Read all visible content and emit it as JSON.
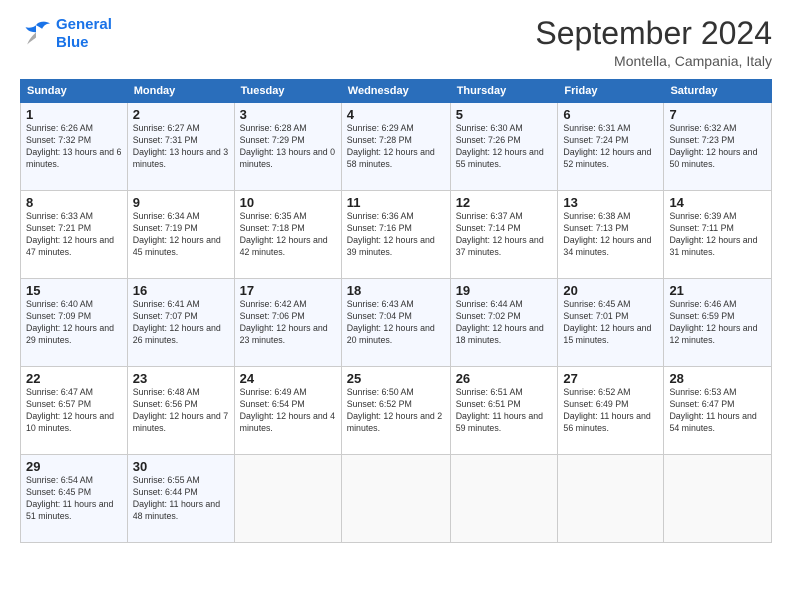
{
  "logo": {
    "line1": "General",
    "line2": "Blue"
  },
  "title": "September 2024",
  "location": "Montella, Campania, Italy",
  "days_of_week": [
    "Sunday",
    "Monday",
    "Tuesday",
    "Wednesday",
    "Thursday",
    "Friday",
    "Saturday"
  ],
  "weeks": [
    [
      {
        "day": "1",
        "sunrise": "6:26 AM",
        "sunset": "7:32 PM",
        "daylight": "13 hours and 6 minutes."
      },
      {
        "day": "2",
        "sunrise": "6:27 AM",
        "sunset": "7:31 PM",
        "daylight": "13 hours and 3 minutes."
      },
      {
        "day": "3",
        "sunrise": "6:28 AM",
        "sunset": "7:29 PM",
        "daylight": "13 hours and 0 minutes."
      },
      {
        "day": "4",
        "sunrise": "6:29 AM",
        "sunset": "7:28 PM",
        "daylight": "12 hours and 58 minutes."
      },
      {
        "day": "5",
        "sunrise": "6:30 AM",
        "sunset": "7:26 PM",
        "daylight": "12 hours and 55 minutes."
      },
      {
        "day": "6",
        "sunrise": "6:31 AM",
        "sunset": "7:24 PM",
        "daylight": "12 hours and 52 minutes."
      },
      {
        "day": "7",
        "sunrise": "6:32 AM",
        "sunset": "7:23 PM",
        "daylight": "12 hours and 50 minutes."
      }
    ],
    [
      {
        "day": "8",
        "sunrise": "6:33 AM",
        "sunset": "7:21 PM",
        "daylight": "12 hours and 47 minutes."
      },
      {
        "day": "9",
        "sunrise": "6:34 AM",
        "sunset": "7:19 PM",
        "daylight": "12 hours and 45 minutes."
      },
      {
        "day": "10",
        "sunrise": "6:35 AM",
        "sunset": "7:18 PM",
        "daylight": "12 hours and 42 minutes."
      },
      {
        "day": "11",
        "sunrise": "6:36 AM",
        "sunset": "7:16 PM",
        "daylight": "12 hours and 39 minutes."
      },
      {
        "day": "12",
        "sunrise": "6:37 AM",
        "sunset": "7:14 PM",
        "daylight": "12 hours and 37 minutes."
      },
      {
        "day": "13",
        "sunrise": "6:38 AM",
        "sunset": "7:13 PM",
        "daylight": "12 hours and 34 minutes."
      },
      {
        "day": "14",
        "sunrise": "6:39 AM",
        "sunset": "7:11 PM",
        "daylight": "12 hours and 31 minutes."
      }
    ],
    [
      {
        "day": "15",
        "sunrise": "6:40 AM",
        "sunset": "7:09 PM",
        "daylight": "12 hours and 29 minutes."
      },
      {
        "day": "16",
        "sunrise": "6:41 AM",
        "sunset": "7:07 PM",
        "daylight": "12 hours and 26 minutes."
      },
      {
        "day": "17",
        "sunrise": "6:42 AM",
        "sunset": "7:06 PM",
        "daylight": "12 hours and 23 minutes."
      },
      {
        "day": "18",
        "sunrise": "6:43 AM",
        "sunset": "7:04 PM",
        "daylight": "12 hours and 20 minutes."
      },
      {
        "day": "19",
        "sunrise": "6:44 AM",
        "sunset": "7:02 PM",
        "daylight": "12 hours and 18 minutes."
      },
      {
        "day": "20",
        "sunrise": "6:45 AM",
        "sunset": "7:01 PM",
        "daylight": "12 hours and 15 minutes."
      },
      {
        "day": "21",
        "sunrise": "6:46 AM",
        "sunset": "6:59 PM",
        "daylight": "12 hours and 12 minutes."
      }
    ],
    [
      {
        "day": "22",
        "sunrise": "6:47 AM",
        "sunset": "6:57 PM",
        "daylight": "12 hours and 10 minutes."
      },
      {
        "day": "23",
        "sunrise": "6:48 AM",
        "sunset": "6:56 PM",
        "daylight": "12 hours and 7 minutes."
      },
      {
        "day": "24",
        "sunrise": "6:49 AM",
        "sunset": "6:54 PM",
        "daylight": "12 hours and 4 minutes."
      },
      {
        "day": "25",
        "sunrise": "6:50 AM",
        "sunset": "6:52 PM",
        "daylight": "12 hours and 2 minutes."
      },
      {
        "day": "26",
        "sunrise": "6:51 AM",
        "sunset": "6:51 PM",
        "daylight": "11 hours and 59 minutes."
      },
      {
        "day": "27",
        "sunrise": "6:52 AM",
        "sunset": "6:49 PM",
        "daylight": "11 hours and 56 minutes."
      },
      {
        "day": "28",
        "sunrise": "6:53 AM",
        "sunset": "6:47 PM",
        "daylight": "11 hours and 54 minutes."
      }
    ],
    [
      {
        "day": "29",
        "sunrise": "6:54 AM",
        "sunset": "6:45 PM",
        "daylight": "11 hours and 51 minutes."
      },
      {
        "day": "30",
        "sunrise": "6:55 AM",
        "sunset": "6:44 PM",
        "daylight": "11 hours and 48 minutes."
      },
      null,
      null,
      null,
      null,
      null
    ]
  ]
}
